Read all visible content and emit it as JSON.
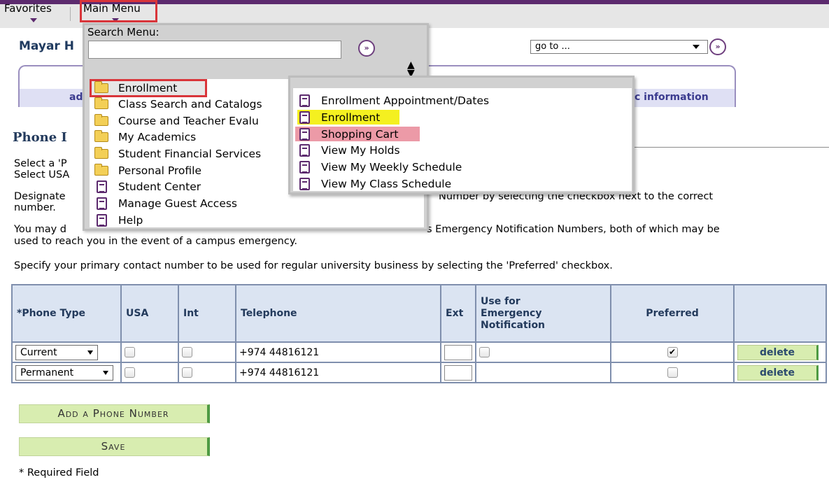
{
  "menubar": {
    "favorites": "Favorites",
    "main_menu": "Main Menu"
  },
  "header": {
    "user_name": "Mayar H",
    "goto": "go to ...",
    "go_symbol": "»"
  },
  "tabs": {
    "sub_left": "ad",
    "sub_right": "c information"
  },
  "page": {
    "title": "Phone Numbers",
    "title_visible": "Phone I",
    "p1_line1": "Select a 'P",
    "p1_line2": "Select USA",
    "p2_line1_left": "Designate",
    "p2_line1_right": "Number by selecting the checkbox next to the correct",
    "p2_line2": "number.",
    "p3_line1_left": "You may d",
    "p3_line1_right": "s Emergency Notification Numbers, both of which may be",
    "p3_line2": "used to reach you in the event of a campus emergency.",
    "p4": "Specify your primary contact number to be used for regular university business by selecting the 'Preferred' checkbox."
  },
  "table": {
    "headers": {
      "phone_type": "*Phone Type",
      "usa": "USA",
      "int": "Int",
      "telephone": "Telephone",
      "ext": "Ext",
      "emergency_1": "Use for",
      "emergency_2": "Emergency",
      "emergency_3": "Notification",
      "preferred": "Preferred"
    },
    "rows": [
      {
        "type": "Current",
        "telephone": "+974 44816121",
        "preferred": true,
        "delete": "delete"
      },
      {
        "type": "Permanent",
        "telephone": "+974 44816121",
        "preferred": false,
        "delete": "delete"
      }
    ]
  },
  "buttons": {
    "add_phone": "Add a Phone Number",
    "save": "Save"
  },
  "required_note": "* Required Field",
  "menu": {
    "search_label": "Search Menu:",
    "items": [
      {
        "label": "Enrollment",
        "icon": "folder-icon"
      },
      {
        "label": "Class Search and Catalogs",
        "icon": "folder-icon"
      },
      {
        "label": "Course and Teacher Evalu",
        "icon": "folder-icon"
      },
      {
        "label": "My Academics",
        "icon": "folder-icon"
      },
      {
        "label": "Student Financial Services",
        "icon": "folder-icon"
      },
      {
        "label": "Personal Profile",
        "icon": "folder-icon"
      },
      {
        "label": "Student Center",
        "icon": "document-icon"
      },
      {
        "label": "Manage Guest Access",
        "icon": "document-icon"
      },
      {
        "label": "Help",
        "icon": "document-icon"
      }
    ],
    "submenu": [
      {
        "label": "Enrollment Appointment/Dates"
      },
      {
        "label": "Enrollment"
      },
      {
        "label": "Shopping Cart"
      },
      {
        "label": "View My Holds"
      },
      {
        "label": "View My Weekly Schedule"
      },
      {
        "label": "View My Class Schedule"
      }
    ]
  },
  "colors": {
    "brand": "#5c2a6e",
    "highlight_yellow": "#f4f020",
    "highlight_pink": "#ec9aa7",
    "annotation_red": "#d9353a",
    "button_green": "#d8edb0"
  }
}
